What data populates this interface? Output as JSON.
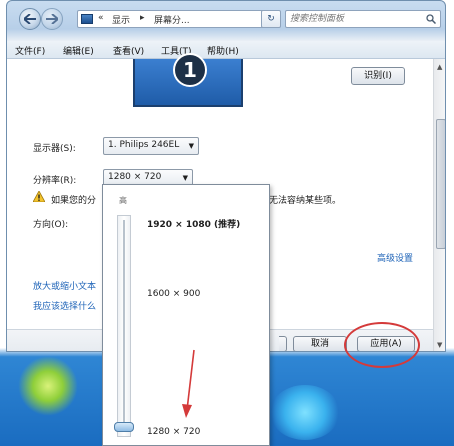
{
  "address_bar": {
    "chevron": "«",
    "crumb_1": "显示",
    "separator": "▸",
    "crumb_2": "屏幕分...",
    "dropdown": "▾",
    "refresh": "↻",
    "search_placeholder": "搜索控制面板"
  },
  "menu": [
    "文件(F)",
    "编辑(E)",
    "查看(V)",
    "工具(T)",
    "帮助(H)"
  ],
  "monitor": {
    "number": "1"
  },
  "identify_label": "识别(I)",
  "display": {
    "label": "显示器(S):",
    "value": "1. Philips 246EL"
  },
  "resolution": {
    "label": "分辨率(R):",
    "value": "1280 × 720"
  },
  "warning": {
    "text_left": "如果您的分",
    "text_right": "无法容纳某些项。"
  },
  "orientation": {
    "label": "方向(O):"
  },
  "advanced_link": "高级设置",
  "links": [
    "放大或缩小文本",
    "我应该选择什么"
  ],
  "buttons": {
    "cancel": "取消",
    "apply": "应用(A)"
  },
  "resolution_list": {
    "high_label": "高",
    "options": [
      "1920 × 1080 (推荐)",
      "1600 × 900",
      "1280 × 720"
    ],
    "slider_position": "lowest"
  },
  "colors": {
    "annotation": "#d43a3a",
    "link": "#1f64b8"
  }
}
